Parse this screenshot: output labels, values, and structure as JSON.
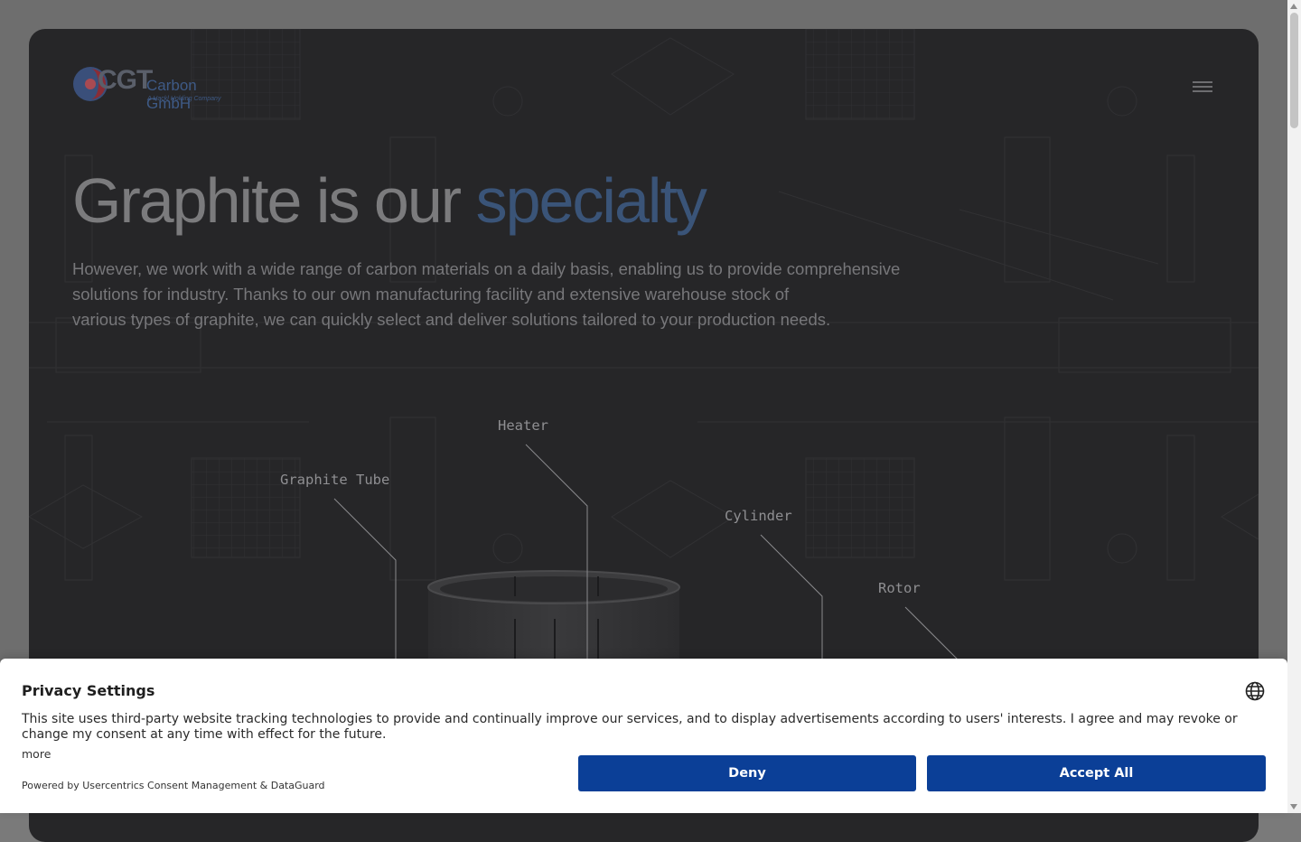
{
  "header": {
    "logo_mark": "CGT",
    "logo_name": "Carbon GmbH",
    "logo_tagline": "A Hackl Holding Company",
    "menu_icon": "hamburger-menu-icon"
  },
  "hero": {
    "title_main": "Graphite is our ",
    "title_accent": "specialty",
    "lead_line1": "However, we work with a wide range of carbon materials on a daily basis, enabling us to provide comprehensive",
    "lead_line2": "solutions for industry. Thanks to our own manufacturing facility and extensive warehouse stock of",
    "lead_line3": "various types of graphite, we can quickly select and deliver solutions tailored to your production needs.",
    "callouts": {
      "heater": "Heater",
      "graphite_tube": "Graphite Tube",
      "cylinder": "Cylinder",
      "rotor": "Rotor"
    }
  },
  "consent": {
    "title": "Privacy Settings",
    "body": "This site uses third-party website tracking technologies to provide and continually improve our services, and to display advertisements according to users' interests. I agree and may revoke or change my consent at any time with effect for the future.",
    "more": "more",
    "powered": "Powered by Usercentrics Consent Management & DataGuard",
    "deny": "Deny",
    "accept": "Accept All",
    "language_icon": "globe-icon"
  },
  "colors": {
    "hero_bg": "#262628",
    "accent": "#3a5478",
    "button": "#0b3f97"
  }
}
